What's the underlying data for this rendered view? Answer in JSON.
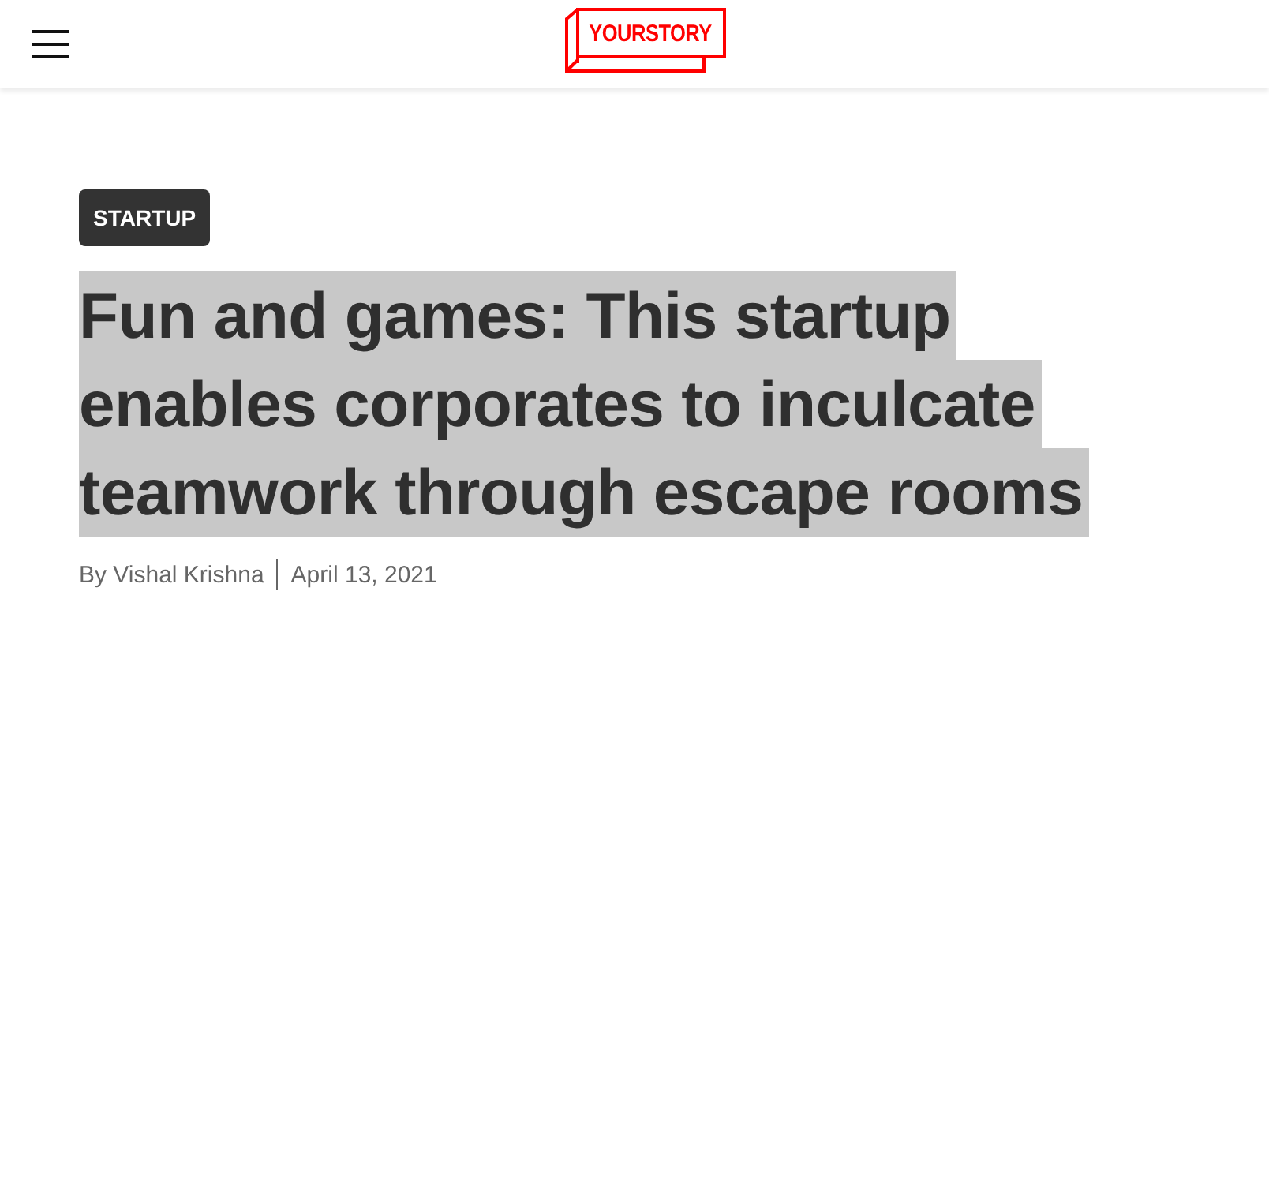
{
  "header": {
    "logo": "YOURSTORY"
  },
  "article": {
    "category": "STARTUP",
    "title": {
      "highlighted": true,
      "lines": [
        "Fun and games: This startup",
        "enables corporates to inculcate",
        "teamwork through escape rooms"
      ]
    },
    "author": "By Vishal Krishna",
    "date": "April 13, 2021"
  }
}
